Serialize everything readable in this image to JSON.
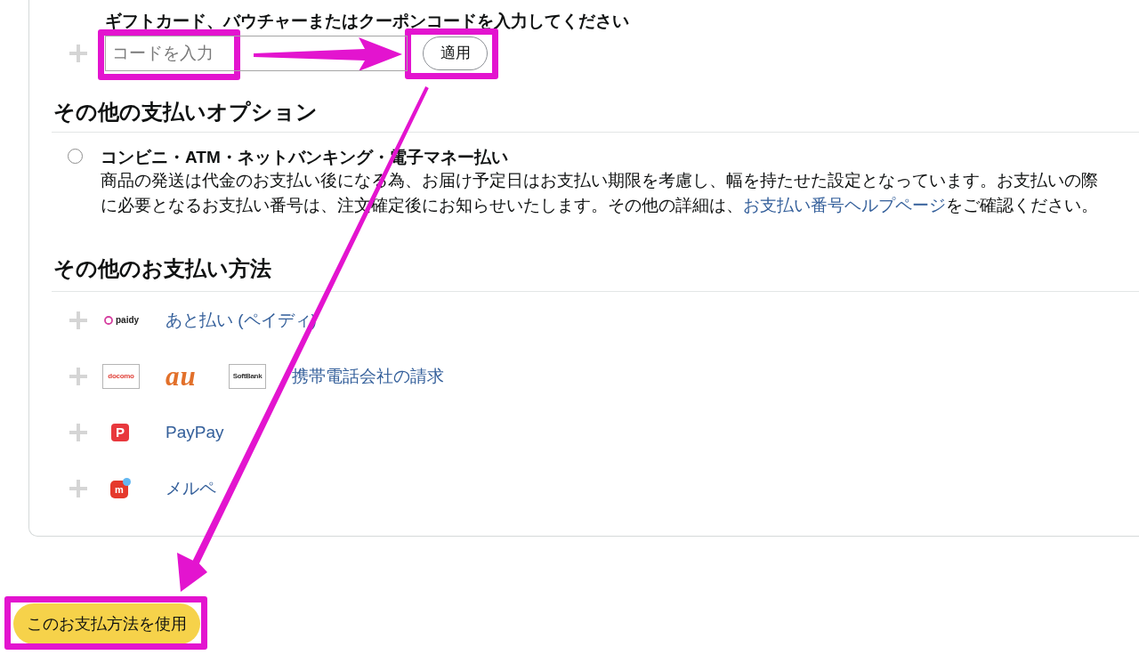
{
  "gift_card": {
    "label": "ギフトカード、バウチャーまたはクーポンコードを入力してください",
    "code_field": {
      "placeholder": "コードを入力",
      "highlighted": true
    },
    "apply_button": {
      "label": "適用",
      "highlighted": true
    }
  },
  "payment_options": {
    "heading": "その他の支払いオプション",
    "options": [
      {
        "title": "コンビニ・ATM・ネットバンキング・電子マネー払い",
        "selected": false,
        "description": [
          {
            "kind": "text",
            "text": "商品の発送は代金のお支払い後になる為、お届け予定日はお支払い期限を考慮し、幅を持たせた設定となっています。お支払いの際に必要となるお支払い番号は、注文確定後にお知らせいたします。その他の詳細は、"
          },
          {
            "kind": "link",
            "text": "お支払い番号ヘルプページ"
          },
          {
            "kind": "text",
            "text": "をご確認ください。"
          }
        ]
      }
    ]
  },
  "payment_methods": {
    "heading": "その他のお支払い方法",
    "methods": [
      {
        "logos": [
          {
            "kind": "ring",
            "text": "paidy",
            "color": "#d63fa0"
          }
        ],
        "label": "あと払い (ペイディ)"
      },
      {
        "logos": [
          {
            "kind": "boxed",
            "text": "docomo",
            "color": "#e2463e"
          },
          {
            "kind": "script",
            "text": "au",
            "color": "#e2702a"
          },
          {
            "kind": "boxed",
            "text": "SoftBank",
            "color": "#333333"
          }
        ],
        "label": "携帯電話会社の請求"
      },
      {
        "logos": [
          {
            "kind": "tile",
            "text": "P",
            "color": "#e8383d"
          }
        ],
        "label": "PayPay"
      },
      {
        "logos": [
          {
            "kind": "cube",
            "text": "m",
            "color": "#e5392c"
          }
        ],
        "label": "メルペ"
      }
    ]
  },
  "submit_button": {
    "label": "このお支払方法を使用",
    "highlighted": true
  }
}
